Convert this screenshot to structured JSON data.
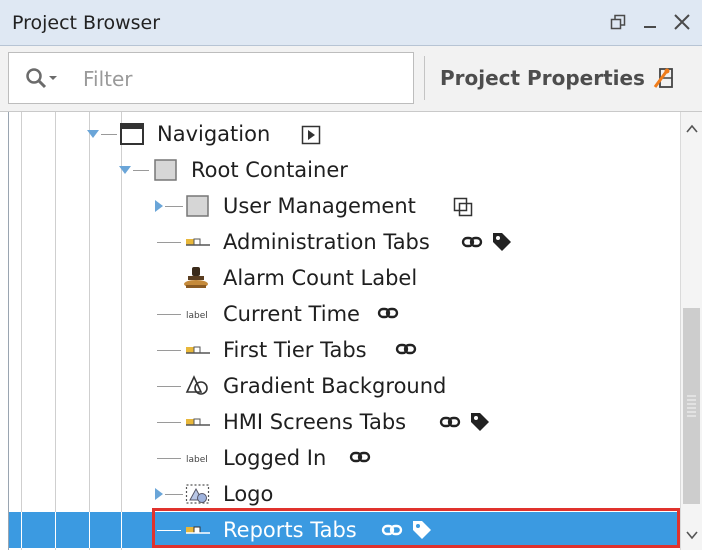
{
  "panel": {
    "title": "Project Browser"
  },
  "toolbar": {
    "filter_placeholder": "Filter",
    "props_label": "Project Properties"
  },
  "colors": {
    "selection": "#3b9ae1",
    "highlight_outline": "#e0322d",
    "titlebar": "#dfe8f3"
  },
  "tree": {
    "navigation": {
      "label": "Navigation",
      "icon": "window-icon"
    },
    "root": {
      "label": "Root Container",
      "icon": "container-icon"
    },
    "children": [
      {
        "label": "User Management",
        "icon": "container-icon"
      },
      {
        "label": "Administration Tabs",
        "icon": "tab-strip-icon"
      },
      {
        "label": "Alarm Count Label",
        "icon": "stamp-icon"
      },
      {
        "label": "Current Time",
        "icon": "label-icon"
      },
      {
        "label": "First Tier Tabs",
        "icon": "tab-strip-icon"
      },
      {
        "label": "Gradient Background",
        "icon": "shapes-icon"
      },
      {
        "label": "HMI Screens Tabs",
        "icon": "tab-strip-icon"
      },
      {
        "label": "Logged In",
        "icon": "label-icon"
      },
      {
        "label": "Logo",
        "icon": "image-icon"
      },
      {
        "label": "Reports Tabs",
        "icon": "tab-strip-icon",
        "selected": true
      }
    ]
  }
}
